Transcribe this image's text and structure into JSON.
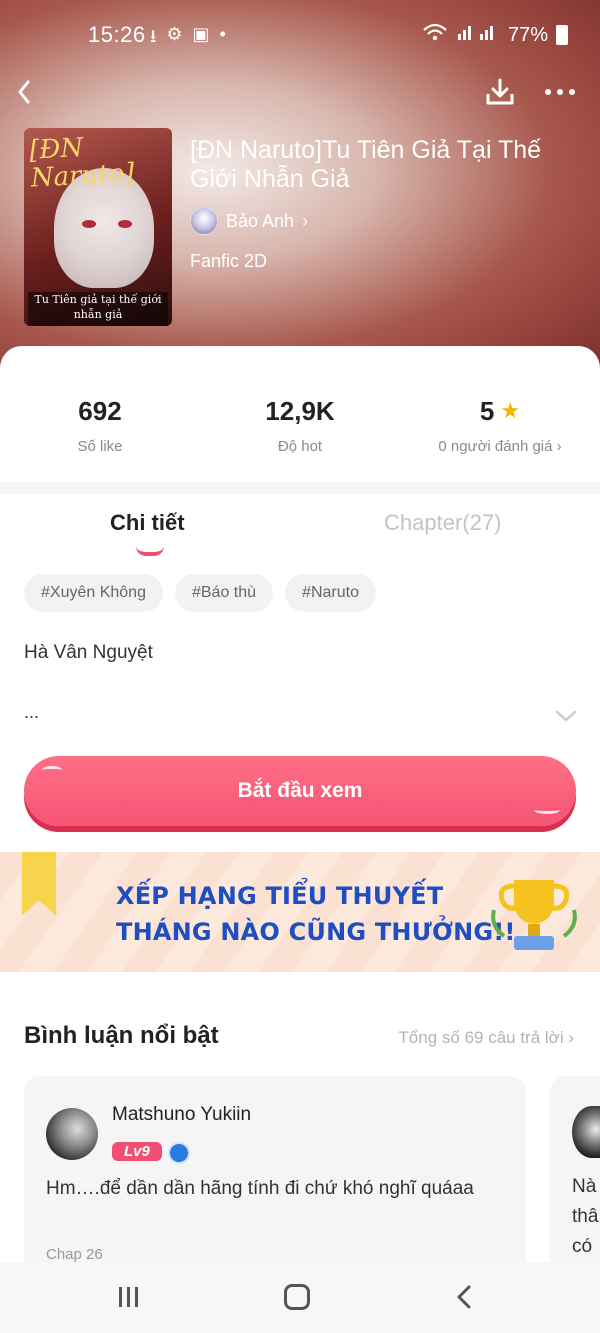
{
  "status_bar": {
    "time": "15:26",
    "battery": "77%"
  },
  "book": {
    "title": "[ĐN Naruto]Tu Tiên Giả Tại Thế Giới Nhẫn Giả",
    "author": "Bảo Anh",
    "genre": "Fanfic 2D",
    "cover_title_line1": "[ĐN",
    "cover_title_line2": "Naruto]",
    "cover_subtitle": "Tu Tiên giả tại thế giới nhẫn giả"
  },
  "stats": {
    "likes_value": "692",
    "likes_label": "Số like",
    "hot_value": "12,9K",
    "hot_label": "Độ hot",
    "rating_value": "5",
    "rating_label": "0 người đánh giá"
  },
  "tabs": {
    "detail": "Chi tiết",
    "chapter": "Chapter(27)"
  },
  "tags": [
    "#Xuyên Không",
    "#Báo thù",
    "#Naruto"
  ],
  "description": {
    "first_line": "Hà Vân Nguyệt",
    "more": "..."
  },
  "start_button": "Bắt đầu xem",
  "banner": {
    "line1": "XẾP HẠNG TIỂU THUYẾT",
    "line2": "THÁNG NÀO CŨNG THƯỞNG!!"
  },
  "comments_section": {
    "title": "Bình luận nổi bật",
    "total_link": "Tổng số 69 câu trả lời",
    "items": [
      {
        "name": "Matshuno Yukiin",
        "level": "Lv9",
        "text": "Hm….để dần dần hãng tính đi chứ khó nghĩ quáaa",
        "chapter": "Chap 26"
      }
    ],
    "peek_text": "Nà\nthâ\ncó"
  },
  "colors": {
    "accent": "#f04e73",
    "banner_text": "#1f4ec1",
    "star": "#f5b400"
  }
}
